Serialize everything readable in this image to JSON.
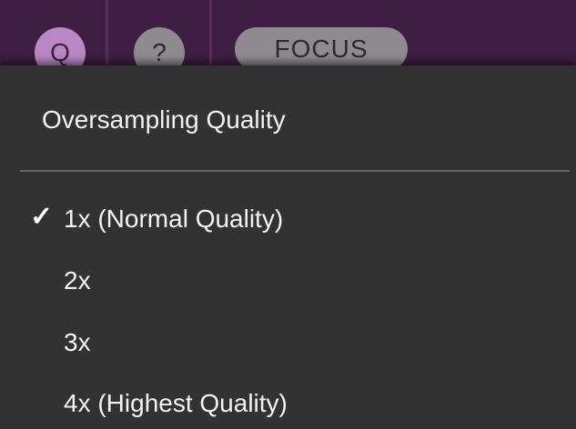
{
  "toolbar": {
    "q_button": "Q",
    "help_button": "?",
    "focus_button": "FOCUS"
  },
  "menu": {
    "header": "Oversampling Quality",
    "items": [
      {
        "label": "1x (Normal Quality)",
        "checked": true,
        "check_glyph": "✓"
      },
      {
        "label": "2x",
        "checked": false
      },
      {
        "label": "3x",
        "checked": false
      },
      {
        "label": "4x (Highest Quality)",
        "checked": false
      }
    ]
  },
  "colors": {
    "toolbar_bg": "#3e1e42",
    "accent_purple": "#b988c4",
    "menu_bg": "#333233",
    "button_grey": "#8e8a8f"
  }
}
